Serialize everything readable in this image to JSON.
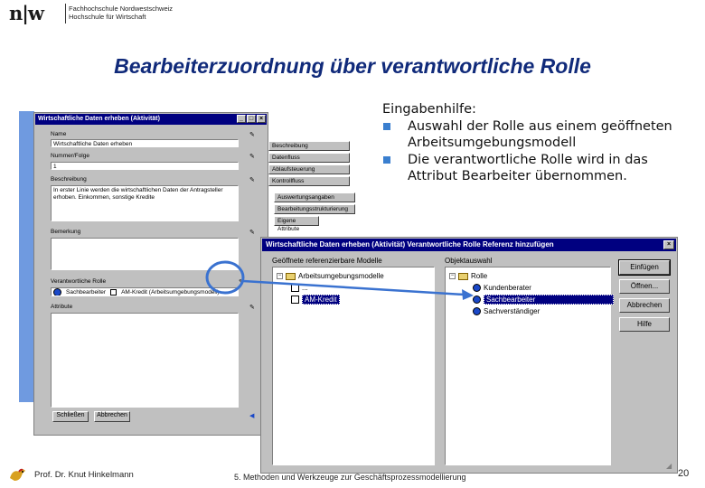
{
  "header": {
    "logo": "n|w",
    "school_line1": "Fachhochschule Nordwestschweiz",
    "school_line2": "Hochschule für Wirtschaft"
  },
  "slide": {
    "title": "Bearbeiterzuordnung über verantwortliche Rolle",
    "intro": "Eingabenhilfe:",
    "bullets": [
      "Auswahl der Rolle aus einem geöffneten Arbeitsumgebungsmodell",
      "Die verantwortliche Rolle wird in das Attribut Bearbeiter übernommen."
    ]
  },
  "window1": {
    "title": "Wirtschaftliche Daten erheben (Aktivität)",
    "labels": {
      "name": "Name",
      "nummer": "Nummer/Folge",
      "beschreibung": "Beschreibung",
      "bemerkung": "Bemerkung",
      "bearbeiter": "Verantwortliche Rolle",
      "attribute": "Attribute"
    },
    "values": {
      "name": "Wirtschaftliche Daten erheben",
      "nummer": "1",
      "beschreibung": "In erster Linie werden die wirtschaftlichen Daten der Antragsteller erhoben. Einkommen, sonstige Kredite",
      "bearbeiter": "Sachbearbeiter",
      "bearbeiter_model": "AM-Kredit (Arbeitsumgebungsmodell)"
    },
    "side_buttons": [
      "Beschreibung",
      "Datenfluss",
      "Ablaufsteuerung",
      "Kontrollfluss",
      "Auswertungsangaben",
      "Bearbeitungsstrukturierung",
      "Eigene Attribute",
      "Simulation",
      "Ereignisse"
    ],
    "ok_label": "Schließen",
    "cancel_label": "Abbrechen",
    "controls": [
      "_",
      "□",
      "×"
    ]
  },
  "window2": {
    "title": "Wirtschaftliche Daten erheben (Aktivität)  Verantwortliche Rolle  Referenz hinzufügen",
    "left_label": "Geöffnete referenzierbare Modelle",
    "right_label": "Objektauswahl",
    "tree_left": {
      "root": "Arbeitsumgebungsmodelle",
      "child1": "...",
      "child2": "AM-Kredit"
    },
    "tree_right": {
      "root": "Rolle",
      "items": [
        "Kundenberater",
        "Sachbearbeiter",
        "Sachverständiger"
      ]
    },
    "buttons": [
      "Einfügen",
      "Öffnen...",
      "Abbrechen",
      "Hilfe"
    ],
    "controls": [
      "×"
    ]
  },
  "footer": {
    "author": "Prof. Dr. Knut Hinkelmann",
    "course": "5. Methoden und Werkzeuge zur Geschäftsprozessmodellierung",
    "page": "20"
  },
  "colors": {
    "title": "#102a7a",
    "bullet": "#3a7fcf",
    "arrow": "#3a72d0",
    "titlebar": "#000080"
  }
}
